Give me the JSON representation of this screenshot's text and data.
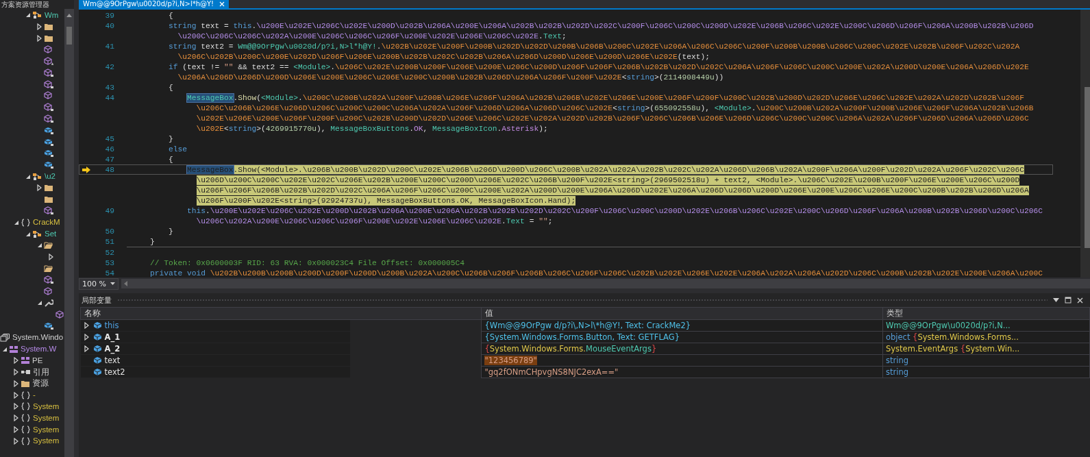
{
  "sidebar": {
    "title": "方案资源管理器",
    "tree": [
      {
        "children": [
          {
            "children": [
              {
                "kind": "class",
                "label": "Wm",
                "expanded": true,
                "children": [
                  {
                    "kind": "folder",
                    "expanded": false
                  },
                  {
                    "kind": "folder",
                    "expanded": false
                  },
                  {
                    "kind": "method",
                    "locked": false,
                    "starred": false
                  },
                  {
                    "kind": "method",
                    "locked": false,
                    "starred": true
                  },
                  {
                    "kind": "method",
                    "locked": true,
                    "starred": false
                  },
                  {
                    "kind": "method",
                    "locked": true,
                    "starred": false
                  },
                  {
                    "kind": "method",
                    "locked": false,
                    "starred": false
                  },
                  {
                    "kind": "method",
                    "locked": true,
                    "starred": false
                  },
                  {
                    "kind": "method",
                    "locked": true,
                    "starred": false
                  },
                  {
                    "kind": "field",
                    "locked": true,
                    "starred": false
                  },
                  {
                    "kind": "field",
                    "locked": true,
                    "starred": false
                  },
                  {
                    "kind": "field",
                    "locked": true,
                    "starred": false
                  },
                  {
                    "kind": "field",
                    "locked": true,
                    "starred": false
                  }
                ]
              },
              {
                "kind": "class",
                "label": "\\u2",
                "expanded": true,
                "children": [
                  {
                    "kind": "folder",
                    "expanded": false
                  },
                  {
                    "kind": "folder"
                  },
                  {
                    "kind": "method",
                    "locked": true,
                    "starred": false
                  }
                ]
              }
            ]
          },
          {
            "kind": "namespace",
            "label": "CrackM",
            "expanded": true,
            "children": [
              {
                "kind": "class",
                "label": "Set",
                "expanded": true,
                "children": [
                  {
                    "kind": "open-folder",
                    "expanded": true,
                    "children": [
                      {
                        "expanded": false
                      }
                    ]
                  },
                  {
                    "kind": "open-folder"
                  },
                  {
                    "kind": "method",
                    "locked": true,
                    "starred": false
                  },
                  {
                    "kind": "method",
                    "locked": false,
                    "starred": false
                  },
                  {
                    "kind": "wrench",
                    "expanded": true,
                    "children": [
                      {
                        "kind": "method",
                        "locked": false,
                        "starred": false
                      }
                    ]
                  },
                  {
                    "kind": "field",
                    "locked": true,
                    "starred": false
                  }
                ]
              }
            ]
          }
        ]
      },
      {
        "kind": "assembly",
        "label": "System.Windo"
      },
      {
        "kind": "module",
        "label": "System.W",
        "expanded": true,
        "children": [
          {
            "kind": "pe",
            "label": "PE",
            "expanded": false
          },
          {
            "kind": "references",
            "label": "引用",
            "expanded": false
          },
          {
            "kind": "folder",
            "label": "资源",
            "expanded": false
          },
          {
            "kind": "namespace",
            "label": "-",
            "expanded": false
          },
          {
            "kind": "namespace",
            "label": "System",
            "expanded": false
          },
          {
            "kind": "namespace",
            "label": "System",
            "expanded": false
          },
          {
            "kind": "namespace",
            "label": "System",
            "expanded": false
          },
          {
            "kind": "namespace",
            "label": "System",
            "expanded": false
          }
        ]
      }
    ]
  },
  "tab": {
    "label": "Wm@@9OrPgw\\u0020d/p?i,N>l*h@Y!",
    "selected": true
  },
  "code": {
    "lines": [
      {
        "number": "39",
        "current": false,
        "rows": [
          {
            "indent": "        ",
            "tokens": [
              {
                "text": "{",
                "kind": "plain"
              }
            ]
          }
        ]
      },
      {
        "number": "40",
        "current": false,
        "rows": [
          {
            "indent": "        ",
            "tokens": [
              {
                "text": "string",
                "kind": "keyword"
              },
              {
                "text": " text = ",
                "kind": "plain"
              },
              {
                "text": "this",
                "kind": "keyword"
              },
              {
                "text": ".",
                "kind": "plain"
              },
              {
                "text": "\\u200E\\u202E\\u206C\\u202E\\u200D\\u202B\\u206A\\u200E\\u206A\\u202B\\u202B\\u202D\\u202C\\u200F\\u206C\\u200C\\u200D\\u202E\\u206B\\u206C\\u202E\\u200C\\u206D\\u206F\\u206A\\u200B\\u202B\\u206D",
                "kind": "field"
              }
            ]
          },
          {
            "indent": "          ",
            "tokens": [
              {
                "text": "\\u200C\\u206C\\u206C\\u202A\\u200E\\u206C\\u206C\\u206F\\u200E\\u202E\\u206E\\u206C\\u202E",
                "kind": "field"
              },
              {
                "text": ".",
                "kind": "plain"
              },
              {
                "text": "Text",
                "kind": "property"
              },
              {
                "text": ";",
                "kind": "plain"
              }
            ]
          }
        ]
      },
      {
        "number": "41",
        "current": false,
        "rows": [
          {
            "indent": "        ",
            "tokens": [
              {
                "text": "string",
                "kind": "keyword"
              },
              {
                "text": " text2 = ",
                "kind": "plain"
              },
              {
                "text": "Wm@@9OrPgw\\u0020d/p?i,N>l*h@Y!",
                "kind": "type"
              },
              {
                "text": ".",
                "kind": "plain"
              },
              {
                "text": "\\u202B\\u202E\\u200F\\u200B\\u202D\\u202D\\u200B\\u206B\\u200C\\u202E\\u206A\\u206C\\u206C\\u200F\\u200B\\u200B\\u206C\\u200C\\u202E\\u202B\\u206F\\u202C\\u202A",
                "kind": "method"
              }
            ]
          },
          {
            "indent": "          ",
            "tokens": [
              {
                "text": "\\u206C\\u202B\\u200C\\u200E\\u202D\\u206F\\u206E\\u200B\\u202B\\u202C\\u202B\\u206A\\u206D\\u200D\\u206E\\u200D\\u206E\\u202E",
                "kind": "method"
              },
              {
                "text": "(text);",
                "kind": "plain"
              }
            ]
          }
        ]
      },
      {
        "number": "42",
        "current": false,
        "rows": [
          {
            "indent": "        ",
            "tokens": [
              {
                "text": "if",
                "kind": "keyword"
              },
              {
                "text": " (text != ",
                "kind": "plain"
              },
              {
                "text": "\"\"",
                "kind": "string"
              },
              {
                "text": " && text2 == ",
                "kind": "plain"
              },
              {
                "text": "<Module>",
                "kind": "type"
              },
              {
                "text": ".",
                "kind": "plain"
              },
              {
                "text": "\\u206C\\u202E\\u200B\\u200F\\u206E\\u200E\\u206C\\u200D\\u206F\\u206F\\u206B\\u202B\\u202D\\u202C\\u206A\\u206F\\u206C\\u200C\\u200E\\u202A\\u200D\\u200E\\u206A\\u206D\\u202E",
                "kind": "method"
              }
            ]
          },
          {
            "indent": "          ",
            "tokens": [
              {
                "text": "\\u206A\\u206D\\u206D\\u200D\\u206E\\u200E\\u206C\\u206E\\u200C\\u200B\\u202B\\u206D\\u206A\\u206F\\u200F\\u202E",
                "kind": "method"
              },
              {
                "text": "<",
                "kind": "plain"
              },
              {
                "text": "string",
                "kind": "keyword"
              },
              {
                "text": ">(",
                "kind": "plain"
              },
              {
                "text": "2114908449u",
                "kind": "number"
              },
              {
                "text": "))",
                "kind": "plain"
              }
            ]
          }
        ]
      },
      {
        "number": "43",
        "current": false,
        "rows": [
          {
            "indent": "        ",
            "tokens": [
              {
                "text": "{",
                "kind": "plain"
              }
            ]
          }
        ]
      },
      {
        "number": "44",
        "current": false,
        "rows": [
          {
            "indent": "            ",
            "tokens": [
              {
                "text": "MessageBox",
                "kind": "ref"
              },
              {
                "text": ".",
                "kind": "plain"
              },
              {
                "text": "Show",
                "kind": "call"
              },
              {
                "text": "(",
                "kind": "plain"
              },
              {
                "text": "<Module>",
                "kind": "type"
              },
              {
                "text": ".",
                "kind": "plain"
              },
              {
                "text": "\\u200C\\u200B\\u202A\\u200F\\u200B\\u206E\\u206F\\u206A\\u202B\\u206B\\u202E\\u206E\\u200E\\u206F\\u200F\\u200C\\u202B\\u200D\\u202D\\u206E\\u206C\\u202E\\u202A\\u202D\\u202B\\u206F",
                "kind": "method"
              }
            ]
          },
          {
            "indent": "              ",
            "tokens": [
              {
                "text": "\\u206C\\u206B\\u206E\\u206D\\u206C\\u200C\\u200C\\u206A\\u202A\\u206F\\u206D\\u206A\\u206D\\u206C\\u202E",
                "kind": "method"
              },
              {
                "text": "<",
                "kind": "plain"
              },
              {
                "text": "string",
                "kind": "keyword"
              },
              {
                "text": ">(",
                "kind": "plain"
              },
              {
                "text": "655092558u",
                "kind": "number"
              },
              {
                "text": "), ",
                "kind": "plain"
              },
              {
                "text": "<Module>",
                "kind": "type"
              },
              {
                "text": ".",
                "kind": "plain"
              },
              {
                "text": "\\u200C\\u200B\\u202A\\u200F\\u200B\\u206E\\u206F\\u206A\\u202B\\u206B",
                "kind": "method"
              }
            ]
          },
          {
            "indent": "              ",
            "tokens": [
              {
                "text": "\\u202E\\u206E\\u200E\\u206F\\u200F\\u200C\\u202B\\u200D\\u202D\\u206E\\u206C\\u202E\\u202A\\u202D\\u202B\\u206F\\u206C\\u206B\\u206E\\u206D\\u206C\\u200C\\u200C\\u206A\\u202A\\u206F\\u206D\\u206A\\u206D\\u206C",
                "kind": "method"
              }
            ]
          },
          {
            "indent": "              ",
            "tokens": [
              {
                "text": "\\u202E",
                "kind": "method"
              },
              {
                "text": "<",
                "kind": "plain"
              },
              {
                "text": "string",
                "kind": "keyword"
              },
              {
                "text": ">(",
                "kind": "plain"
              },
              {
                "text": "4269915770u",
                "kind": "number"
              },
              {
                "text": "), ",
                "kind": "plain"
              },
              {
                "text": "MessageBoxButtons",
                "kind": "type"
              },
              {
                "text": ".",
                "kind": "plain"
              },
              {
                "text": "OK",
                "kind": "enum"
              },
              {
                "text": ", ",
                "kind": "plain"
              },
              {
                "text": "MessageBoxIcon",
                "kind": "type"
              },
              {
                "text": ".",
                "kind": "plain"
              },
              {
                "text": "Asterisk",
                "kind": "enum"
              },
              {
                "text": ");",
                "kind": "plain"
              }
            ]
          }
        ]
      },
      {
        "number": "45",
        "current": false,
        "rows": [
          {
            "indent": "        ",
            "tokens": [
              {
                "text": "}",
                "kind": "plain"
              }
            ]
          }
        ]
      },
      {
        "number": "46",
        "current": false,
        "rows": [
          {
            "indent": "        ",
            "tokens": [
              {
                "text": "else",
                "kind": "keyword"
              }
            ]
          }
        ]
      },
      {
        "number": "47",
        "current": false,
        "rows": [
          {
            "indent": "        ",
            "tokens": [
              {
                "text": "{",
                "kind": "plain"
              }
            ]
          }
        ]
      },
      {
        "number": "48",
        "current": true,
        "rows": [
          {
            "indent": "            ",
            "tokens": [
              {
                "text": "MessageBox",
                "kind": "ref"
              },
              {
                "text": ".",
                "kind": "plain"
              },
              {
                "text": "Show",
                "kind": "call"
              },
              {
                "text": "(",
                "kind": "plain"
              },
              {
                "text": "<Module>",
                "kind": "type"
              },
              {
                "text": ".",
                "kind": "plain"
              },
              {
                "text": "\\u206B\\u200B\\u202D\\u200C\\u202E\\u206B\\u206D\\u200D\\u206C\\u200B\\u202A\\u202A\\u202B\\u202C\\u202A\\u206D\\u206B\\u202A\\u200F\\u206A\\u200F\\u202D\\u202A\\u206F\\u202C\\u206C",
                "kind": "method"
              }
            ]
          },
          {
            "indent": "              ",
            "tokens": [
              {
                "text": "\\u206D\\u200C\\u200C\\u202E\\u202C\\u206E\\u202B\\u200E\\u200C\\u200D\\u206E\\u202C\\u206B\\u200F\\u202E",
                "kind": "method"
              },
              {
                "text": "<",
                "kind": "plain"
              },
              {
                "text": "string",
                "kind": "keyword"
              },
              {
                "text": ">(",
                "kind": "plain"
              },
              {
                "text": "2969502518u",
                "kind": "number"
              },
              {
                "text": ") + text2, ",
                "kind": "plain"
              },
              {
                "text": "<Module>",
                "kind": "type"
              },
              {
                "text": ".",
                "kind": "plain"
              },
              {
                "text": "\\u206C\\u202E\\u200B\\u200F\\u206E\\u200E\\u206C\\u200D",
                "kind": "method"
              }
            ]
          },
          {
            "indent": "              ",
            "tokens": [
              {
                "text": "\\u206F\\u206F\\u206B\\u202B\\u202D\\u202C\\u206A\\u206F\\u206C\\u200C\\u200E\\u202A\\u200D\\u200E\\u206A\\u206D\\u202E\\u206A\\u206D\\u206D\\u200D\\u206E\\u200E\\u206C\\u206E\\u200C\\u200B\\u202B\\u206D\\u206A",
                "kind": "method"
              }
            ]
          },
          {
            "indent": "              ",
            "tokens": [
              {
                "text": "\\u206F\\u200F\\u202E",
                "kind": "method"
              },
              {
                "text": "<",
                "kind": "plain"
              },
              {
                "text": "string",
                "kind": "keyword"
              },
              {
                "text": ">(",
                "kind": "plain"
              },
              {
                "text": "92924737u",
                "kind": "number"
              },
              {
                "text": "), ",
                "kind": "plain"
              },
              {
                "text": "MessageBoxButtons",
                "kind": "type"
              },
              {
                "text": ".",
                "kind": "plain"
              },
              {
                "text": "OK",
                "kind": "enum"
              },
              {
                "text": ", ",
                "kind": "plain"
              },
              {
                "text": "MessageBoxIcon",
                "kind": "type"
              },
              {
                "text": ".",
                "kind": "plain"
              },
              {
                "text": "Hand",
                "kind": "enum"
              },
              {
                "text": ");",
                "kind": "plain"
              }
            ]
          }
        ]
      },
      {
        "number": "49",
        "current": false,
        "rows": [
          {
            "indent": "            ",
            "tokens": [
              {
                "text": "this",
                "kind": "keyword"
              },
              {
                "text": ".",
                "kind": "plain"
              },
              {
                "text": "\\u200E\\u202E\\u206C\\u202E\\u200D\\u202B\\u206A\\u200E\\u206A\\u202B\\u202B\\u202D\\u202C\\u200F\\u206C\\u200C\\u200D\\u202E\\u206B\\u206C\\u202E\\u200C\\u206D\\u206F\\u206A\\u200B\\u202B\\u206D\\u200C\\u206C",
                "kind": "field"
              }
            ]
          },
          {
            "indent": "              ",
            "tokens": [
              {
                "text": "\\u206C\\u202A\\u200E\\u206C\\u206C\\u206F\\u200E\\u202E\\u206E\\u206C\\u202E",
                "kind": "field"
              },
              {
                "text": ".",
                "kind": "plain"
              },
              {
                "text": "Text",
                "kind": "property"
              },
              {
                "text": " = ",
                "kind": "plain"
              },
              {
                "text": "\"\"",
                "kind": "string"
              },
              {
                "text": ";",
                "kind": "plain"
              }
            ]
          }
        ]
      },
      {
        "number": "50",
        "current": false,
        "rows": [
          {
            "indent": "        ",
            "tokens": [
              {
                "text": "}",
                "kind": "plain"
              }
            ]
          }
        ]
      },
      {
        "number": "51",
        "current": false,
        "rows": [
          {
            "indent": "    ",
            "tokens": [
              {
                "text": "}",
                "kind": "plain"
              }
            ]
          }
        ]
      },
      {
        "number": "52",
        "current": false,
        "divider": true
      },
      {
        "number": "53",
        "current": false,
        "rows": [
          {
            "indent": "    ",
            "tokens": [
              {
                "text": "// Token: 0x0600003F RID: 63 RVA: 0x000023C4 File Offset: 0x000005C4",
                "kind": "comment"
              }
            ]
          }
        ]
      },
      {
        "number": "54",
        "current": false,
        "rows": [
          {
            "indent": "    ",
            "tokens": [
              {
                "text": "private void ",
                "kind": "keyword"
              },
              {
                "text": "\\u202B\\u200B\\u200B\\u200D\\u200F\\u200D\\u200B\\u202A\\u200C\\u206B\\u206F\\u206B\\u206C\\u206F\\u206C\\u202B\\u202E\\u206E\\u202E\\u206A\\u202A\\u206A\\u202D\\u206C\\u200B\\u202B\\u202E\\u200E\\u206A\\u200C",
                "kind": "method"
              }
            ]
          }
        ]
      }
    ]
  },
  "zoom": "100 %",
  "locals": {
    "title": "局部变量",
    "columns": [
      "名称",
      "值",
      "类型"
    ],
    "rows": [
      {
        "name": "this",
        "kind": "this",
        "has_children": true,
        "changed": false,
        "value": [
          {
            "text": "{Wm@@9OrPgw d/p?i\\,N>l\\*h@Y!, Text: CrackMe2}",
            "kind": "value"
          }
        ],
        "type": [
          {
            "text": "Wm@@9OrPgw\\u0020d/p?i,N...",
            "kind": "class"
          }
        ]
      },
      {
        "name": "A_1",
        "kind": "parameter",
        "has_children": true,
        "changed": false,
        "value": [
          {
            "text": "{System.Windows.Forms.Button, Text: GETFLAG}",
            "kind": "value"
          }
        ],
        "type": [
          {
            "text": "object ",
            "kind": "keyword"
          },
          {
            "text": "{",
            "kind": "brace"
          },
          {
            "text": "System.Windows.Forms...",
            "kind": "namespace"
          }
        ]
      },
      {
        "name": "A_2",
        "kind": "parameter",
        "has_children": true,
        "changed": false,
        "value": [
          {
            "text": "{",
            "kind": "brace"
          },
          {
            "text": "System.Windows.Forms.",
            "kind": "namespace"
          },
          {
            "text": "MouseEventArgs",
            "kind": "class"
          },
          {
            "text": "}",
            "kind": "brace"
          }
        ],
        "type": [
          {
            "text": "System.EventArgs ",
            "kind": "namespace"
          },
          {
            "text": "{",
            "kind": "brace"
          },
          {
            "text": "System.Win...",
            "kind": "namespace"
          }
        ]
      },
      {
        "name": "text",
        "kind": "local",
        "has_children": false,
        "changed": true,
        "value": [
          {
            "text": "\"123456789\"",
            "kind": "string"
          }
        ],
        "type": [
          {
            "text": "string",
            "kind": "keyword"
          }
        ]
      },
      {
        "name": "text2",
        "kind": "local",
        "has_children": false,
        "changed": false,
        "value": [
          {
            "text": "\"gq2fONmCHpvgNS8NJC2exA==\"",
            "kind": "string"
          }
        ],
        "type": [
          {
            "text": "string",
            "kind": "keyword"
          }
        ]
      }
    ]
  }
}
